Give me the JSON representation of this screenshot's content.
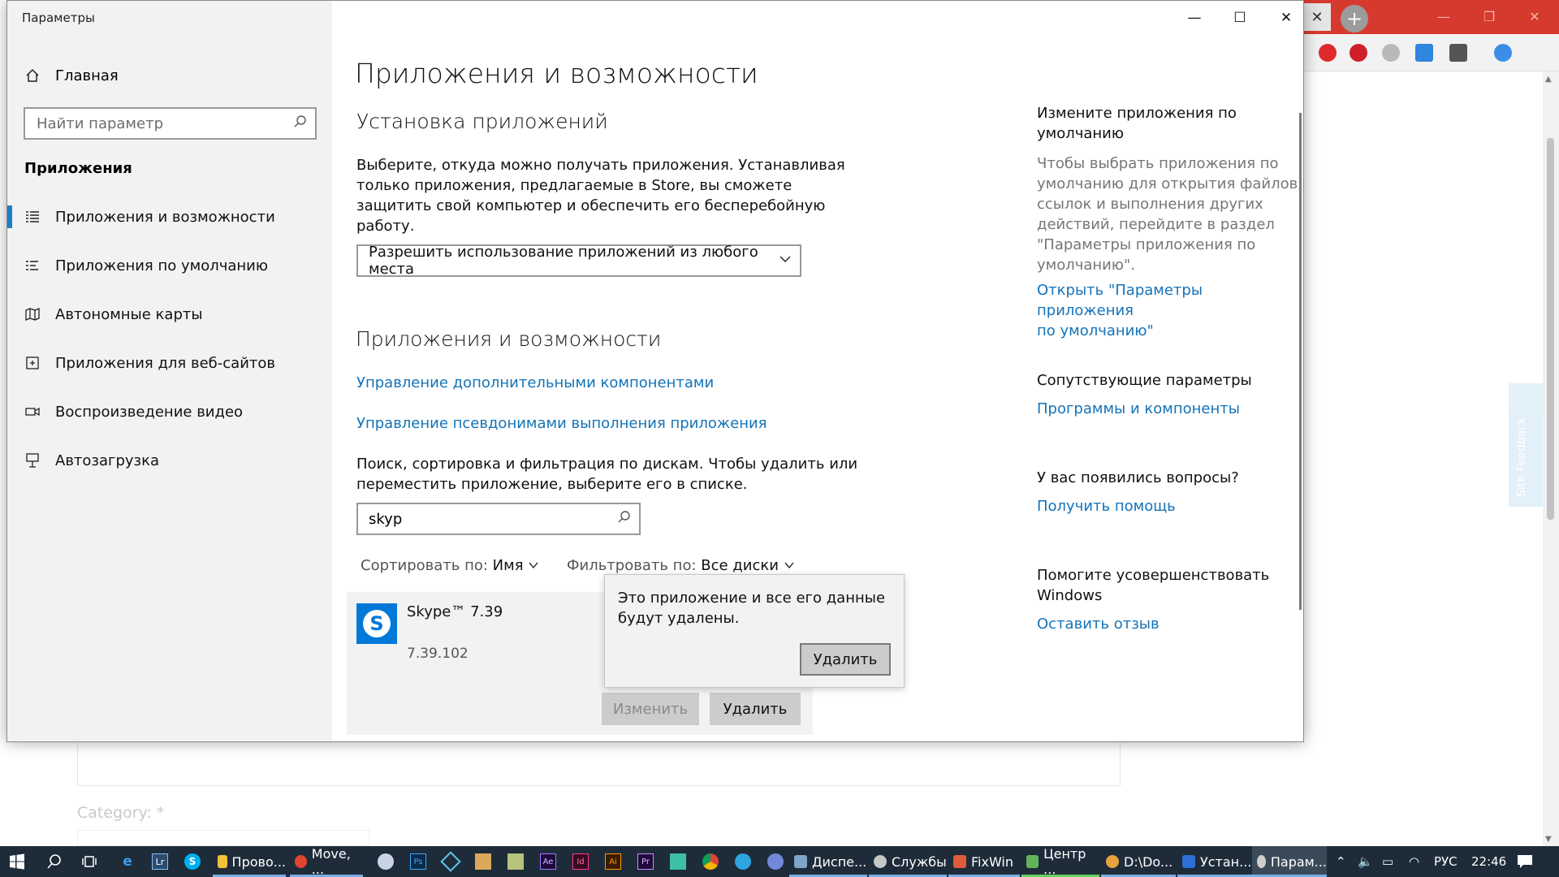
{
  "window": {
    "title": "Параметры",
    "minimize": "—",
    "maximize": "☐",
    "close": "✕"
  },
  "sidebar": {
    "home": "Главная",
    "search_placeholder": "Найти параметр",
    "section": "Приложения",
    "items": [
      {
        "label": "Приложения и возможности",
        "icon": "apps-features-icon"
      },
      {
        "label": "Приложения по умолчанию",
        "icon": "default-apps-icon"
      },
      {
        "label": "Автономные карты",
        "icon": "offline-maps-icon"
      },
      {
        "label": "Приложения для веб-сайтов",
        "icon": "apps-websites-icon"
      },
      {
        "label": "Воспроизведение видео",
        "icon": "video-playback-icon"
      },
      {
        "label": "Автозагрузка",
        "icon": "startup-icon"
      }
    ]
  },
  "main": {
    "page_title": "Приложения и возможности",
    "install": {
      "heading": "Установка приложений",
      "description_lines": [
        "Выберите, откуда можно получать приложения. Устанавливая",
        "только приложения, предлагаемые в Store, вы сможете",
        "защитить свой компьютер и обеспечить его бесперебойную",
        "работу."
      ],
      "dropdown_value": "Разрешить использование приложений из любого места"
    },
    "apps": {
      "heading": "Приложения и возможности",
      "link_components": "Управление дополнительными компонентами",
      "link_aliases": "Управление псевдонимами выполнения приложения",
      "search_hint_lines": [
        "Поиск, сортировка и фильтрация по дискам. Чтобы удалить или",
        "переместить приложение, выберите его в списке."
      ],
      "search_value": "skyp",
      "sort_label": "Сортировать по:",
      "sort_value": "Имя",
      "filter_label": "Фильтровать по:",
      "filter_value": "Все диски",
      "selected_app": {
        "name": "Skype™ 7.39",
        "version": "7.39.102"
      },
      "modify_button": "Изменить",
      "uninstall_button": "Удалить"
    },
    "flyout": {
      "lines": [
        "Это приложение и все его данные",
        "будут удалены."
      ],
      "button": "Удалить"
    }
  },
  "right": {
    "default_title_lines": [
      "Измените приложения по",
      "умолчанию"
    ],
    "default_desc_lines": [
      "Чтобы выбрать приложения по",
      "умолчанию для открытия файлов,",
      "ссылок и выполнения других",
      "действий, перейдите в раздел",
      "\"Параметры приложения по",
      "умолчанию\"."
    ],
    "default_link_lines": [
      "Открыть \"Параметры приложения",
      "по умолчанию\""
    ],
    "related_title": "Сопутствующие параметры",
    "related_link": "Программы и компоненты",
    "questions_title": "У вас появились вопросы?",
    "questions_link": "Получить помощь",
    "improve_title_lines": [
      "Помогите усовершенствовать",
      "Windows"
    ],
    "improve_link": "Оставить отзыв"
  },
  "browser": {
    "category_label": "Category: *",
    "site_feedback": "Site Feedback"
  },
  "taskbar": {
    "apps": [
      {
        "label": "Прово...",
        "color": "#f0c23c"
      },
      {
        "label": "Move, ...",
        "color": "#e2452f"
      },
      {
        "label": "Диспе...",
        "color": "#7fa6c9"
      },
      {
        "label": "Службы",
        "color": "#c7c7c7"
      },
      {
        "label": "FixWin",
        "color": "#e05b3b"
      },
      {
        "label": "Центр ...",
        "color": "#62b35a"
      },
      {
        "label": "D:\\Do...",
        "color": "#e6a23c"
      },
      {
        "label": "Устан...",
        "color": "#2d6fd6"
      },
      {
        "label": "Парам...",
        "color": "#cfcfcf"
      }
    ],
    "lang": "РУС",
    "time": "22:46"
  },
  "colors": {
    "accent": "#1f7ec6",
    "link": "#1473b8",
    "taskbar": "#1e2c3a",
    "chrome_red": "#d63a2e"
  }
}
